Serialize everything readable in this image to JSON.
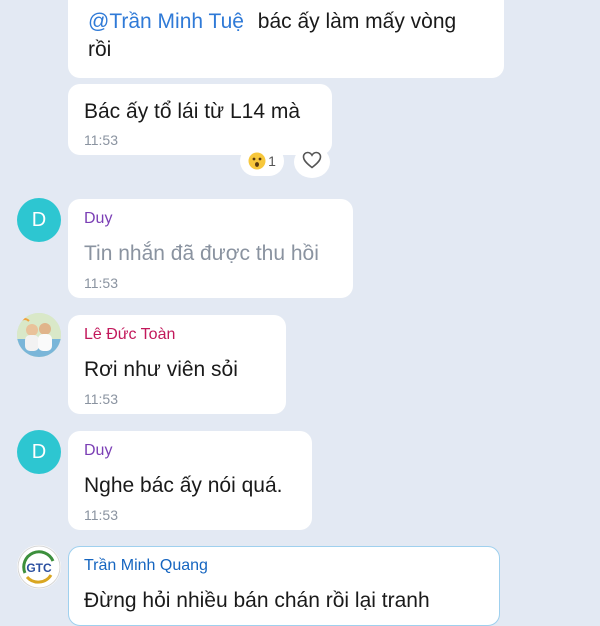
{
  "messages": [
    {
      "mention": "@Trần Minh Tuệ",
      "text_line1": "bác ấy làm mấy vòng",
      "text_line2": "rồi"
    },
    {
      "text": "Bác ấy tổ lái từ L14 mà",
      "time": "11:53",
      "reaction": {
        "emoji_icon": "surprised-face-icon",
        "count": "1"
      }
    },
    {
      "sender": "Duy",
      "avatar_letter": "D",
      "text": "Tin nhắn đã được thu hồi",
      "time": "11:53"
    },
    {
      "sender": "Lê Đức Toàn",
      "avatar_icon": "photo-avatar",
      "text": "Rơi như viên sỏi",
      "time": "11:53"
    },
    {
      "sender": "Duy",
      "avatar_letter": "D",
      "text": "Nghe bác ấy nói quá.",
      "time": "11:53"
    },
    {
      "sender": "Trần Minh Quang",
      "avatar_icon": "logo-avatar",
      "text": "Đừng hỏi nhiều bán chán rồi lại tranh"
    }
  ],
  "colors": {
    "background": "#e3e9f3",
    "mention": "#2f7ad7",
    "sender_duy": "#7b3fb5",
    "sender_toan": "#c2185b",
    "sender_quang": "#1565c0",
    "avatar_letter_bg": "#2dc6d1",
    "time": "#8a93a0",
    "recalled_text": "#8a93a0"
  }
}
